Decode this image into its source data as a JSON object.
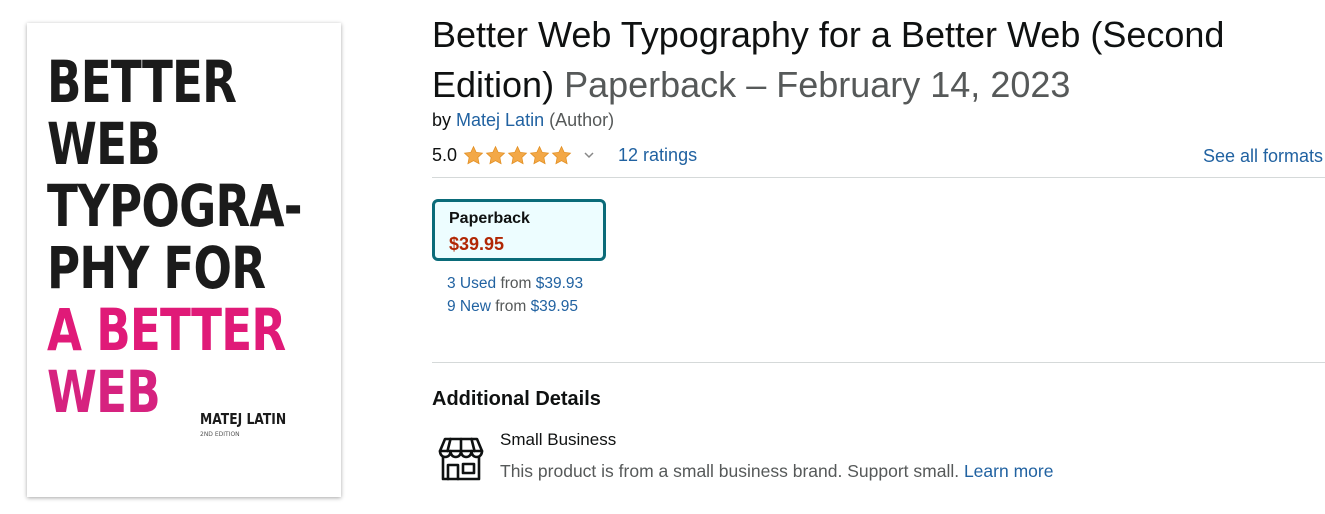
{
  "cover": {
    "lines": [
      "BETTER",
      "WEB",
      "TYPOGRA-",
      "PHY FOR",
      "A BETTER",
      "WEB"
    ],
    "author": "MATEJ LATIN",
    "edition": "2ND EDITION",
    "colors": {
      "dark": "#1b1b1b",
      "pink": "#e01a78"
    }
  },
  "product": {
    "title": "Better Web Typography for a Better Web (Second Edition)",
    "format_date": "Paperback – February 14, 2023",
    "by_prefix": "by",
    "author": "Matej Latin",
    "author_role": "(Author)"
  },
  "rating": {
    "value": "5.0",
    "stars": 5,
    "star_color": "#f3a847",
    "ratings_link": "12 ratings"
  },
  "see_all_formats": "See all formats",
  "format_card": {
    "name": "Paperback",
    "price": "$39.95",
    "border_color": "#0a6b79",
    "price_color": "#b12704"
  },
  "offers": [
    {
      "link": "3 Used",
      "from": "from",
      "price": "$39.93"
    },
    {
      "link": "9 New",
      "from": "from",
      "price": "$39.95"
    }
  ],
  "additional_details": {
    "heading": "Additional Details",
    "icon": "storefront-icon",
    "title": "Small Business",
    "description": "This product is from a small business brand. Support small.",
    "learn_more": "Learn more"
  },
  "link_color": "#2162a1"
}
